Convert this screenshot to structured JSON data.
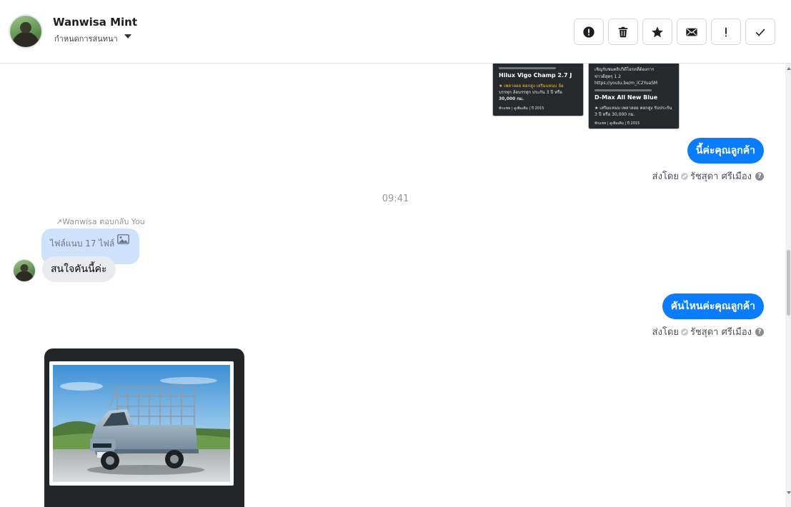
{
  "header": {
    "contact_name": "Wanwisa Mint",
    "contact_subtitle": "กำหนดการสนทนา",
    "buttons": [
      {
        "name": "report-button",
        "icon": "alert-circle-icon"
      },
      {
        "name": "delete-button",
        "icon": "trash-icon"
      },
      {
        "name": "star-button",
        "icon": "star-icon"
      },
      {
        "name": "mail-button",
        "icon": "envelope-icon"
      },
      {
        "name": "important-button",
        "icon": "exclamation-icon"
      },
      {
        "name": "done-button",
        "icon": "check-icon"
      }
    ]
  },
  "thumbnails": {
    "left": {
      "title": "Hilux Vigo Champ 2.7 J",
      "line1": "★ เพลาลอย คอกสูง เสริมแหนบ ล้อ",
      "line2": "บรรทุก ล้อบรรทุก ประกัน 3 ปี หรือ",
      "line3": "30,000 กม.",
      "footer": "ทักแชท   |   ดูเพิ่มเติม   |   ปี 2015"
    },
    "right": {
      "top1": "เชิญรับชมคลิปวิดีโอรถที่ต้องการ",
      "top2": "ข่าวดีสุดๆ 1 2",
      "link": "https://youtu.be/m_iC2YuaSM",
      "title": "D-Max All New Blue",
      "line1": "★ เสริมแหนบ เพลาลอย คอกสูง รับประกัน",
      "line2": "3 ปี หรือ 30,000 กม.",
      "footer": "ทักแชท   |   ดูเพิ่มเติม   |   ปี 2015"
    }
  },
  "messages": {
    "out1": "นี้ค่ะคุณลูกค้า",
    "sent_by_label": "ส่งโดย",
    "sent_by_name": "รัชสุดา ศรีเมือง",
    "help_glyph": "?",
    "time_separator": "09:41",
    "reply_note": "Wanwisa ตอบกลับ You",
    "reply_quote": "ไฟล์แนบ 17 ไฟล์",
    "incoming": "สนใจคันนี้ค่ะ",
    "out2": "คันไหนค่ะคุณลูกค้า"
  },
  "colors": {
    "accent": "#0a7cff",
    "reply_bubble": "#cfe2fb",
    "incoming_bubble": "#e9ebee"
  }
}
